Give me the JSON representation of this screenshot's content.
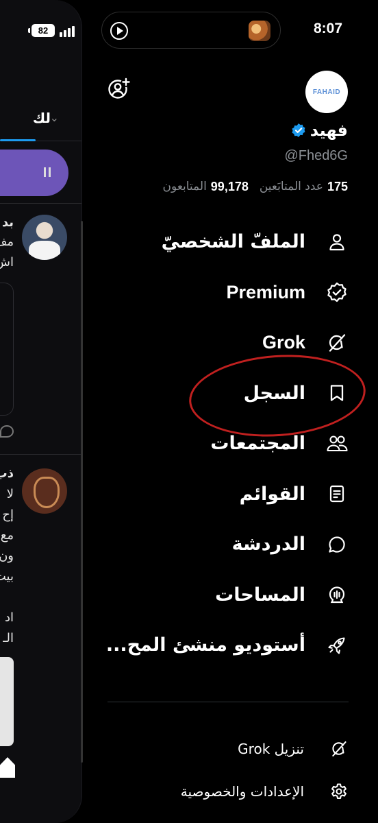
{
  "status_bar": {
    "time": "8:07",
    "battery": "82"
  },
  "timeline_peek": {
    "tab_label": "لك",
    "snippets": [
      "بد",
      "مف",
      "اش",
      "ذب",
      "لا",
      "إح",
      "مع",
      "ون",
      "بيت",
      "اد",
      "الـ"
    ]
  },
  "profile": {
    "avatar_text": "FAHAID",
    "display_name": "فهيد",
    "handle": "@Fhed6G",
    "following_count": "175",
    "following_label": "عدد المتابَعين",
    "followers_count": "99,178",
    "followers_label": "المتابعون"
  },
  "menu": {
    "items": [
      {
        "label": "الملفّ الشخصيّ",
        "icon": "profile-icon"
      },
      {
        "label": "Premium",
        "icon": "premium-badge-icon"
      },
      {
        "label": "Grok",
        "icon": "grok-icon"
      },
      {
        "label": "السجل",
        "icon": "bookmark-icon"
      },
      {
        "label": "المجتمعات",
        "icon": "communities-icon"
      },
      {
        "label": "القوائم",
        "icon": "lists-icon"
      },
      {
        "label": "الدردشة",
        "icon": "chat-icon"
      },
      {
        "label": "المساحات",
        "icon": "spaces-icon"
      },
      {
        "label": "أستوديو منشئ المح...",
        "icon": "rocket-icon"
      }
    ]
  },
  "footer": {
    "download_grok": "تنزيل Grok",
    "settings_privacy": "الإعدادات والخصوصية"
  },
  "colors": {
    "background": "#000000",
    "verified_blue": "#1d9bf0",
    "secondary_text": "#8b8f94",
    "annotation_red": "#c0201f",
    "pill_purple": "#6d55b8"
  }
}
